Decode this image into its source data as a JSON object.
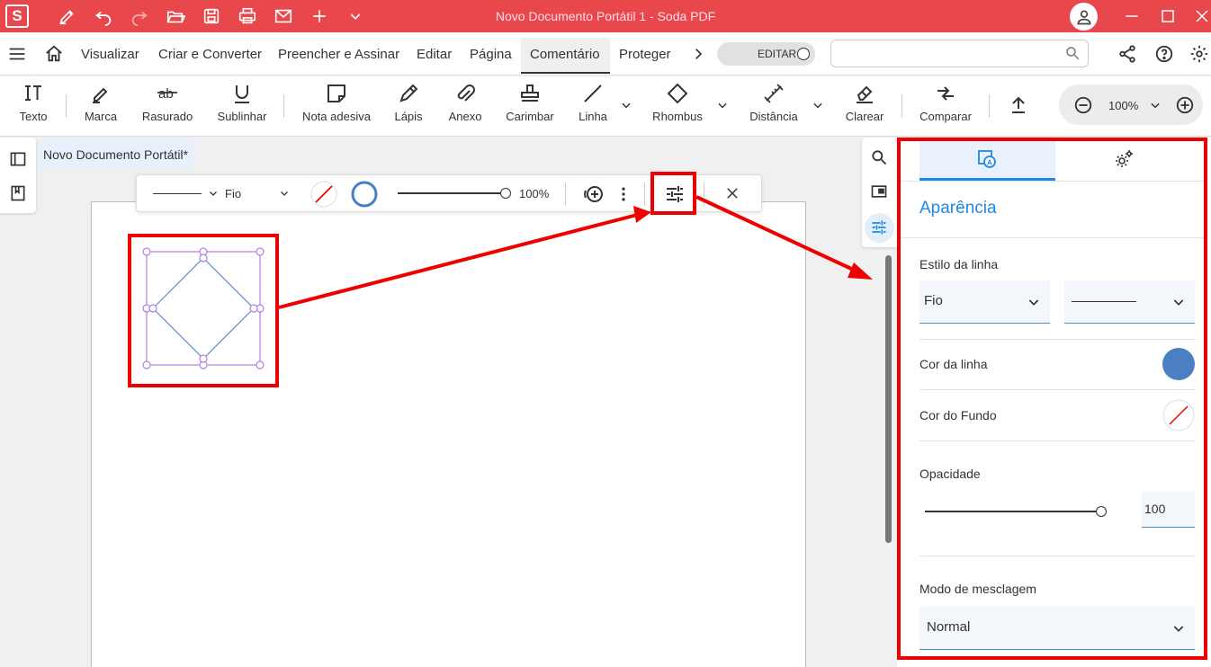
{
  "titlebar": {
    "app_logo": "S",
    "title": "Novo Documento Portátil 1   -   Soda PDF"
  },
  "menubar": {
    "items": [
      "Visualizar",
      "Criar e Converter",
      "Preencher e Assinar",
      "Editar",
      "Página",
      "Comentário",
      "Proteger"
    ],
    "active": "Comentário",
    "edit_toggle_label": "EDITAR",
    "search_placeholder": ""
  },
  "toolbar": {
    "tools": [
      {
        "label": "Texto",
        "icon": "text-icon"
      },
      {
        "label": "Marca",
        "icon": "highlighter-icon"
      },
      {
        "label": "Rasurado",
        "icon": "strikethrough-icon"
      },
      {
        "label": "Sublinhar",
        "icon": "underline-icon"
      },
      {
        "label": "Nota adesiva",
        "icon": "sticky-note-icon"
      },
      {
        "label": "Lápis",
        "icon": "pencil-icon"
      },
      {
        "label": "Anexo",
        "icon": "paperclip-icon"
      },
      {
        "label": "Carimbar",
        "icon": "stamp-icon"
      },
      {
        "label": "Linha",
        "icon": "line-icon"
      },
      {
        "label": "Rhombus",
        "icon": "rhombus-icon"
      },
      {
        "label": "Distância",
        "icon": "distance-icon"
      },
      {
        "label": "Clarear",
        "icon": "eraser-icon"
      },
      {
        "label": "Comparar",
        "icon": "compare-icon"
      }
    ],
    "zoom": "100%"
  },
  "document": {
    "tab_title": "Novo Documento Portátil*"
  },
  "floating_bar": {
    "line_style": "Fio",
    "opacity": "100%"
  },
  "panel": {
    "heading": "Aparência",
    "line_style_label": "Estilo da linha",
    "line_style_value": "Fio",
    "line_color_label": "Cor da linha",
    "line_color": "#4a7fc1",
    "fill_color_label": "Cor do Fundo",
    "opacity_label": "Opacidade",
    "opacity_value": "100",
    "opacity_fraction": 1.0,
    "blend_mode_label": "Modo de mesclagem",
    "blend_mode_value": "Normal"
  },
  "colors": {
    "brand": "#e8474c",
    "accent": "#1e88e5",
    "highlight": "#e00000"
  }
}
